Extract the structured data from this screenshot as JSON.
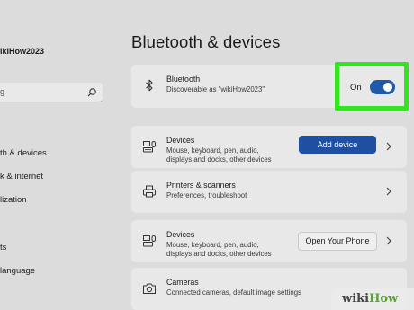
{
  "sidebar": {
    "account_name": "ikiHow2023",
    "search_value": "g",
    "items": [
      {
        "label": "th & devices"
      },
      {
        "label": "k & internet"
      },
      {
        "label": "lization"
      },
      {
        "label": "ts"
      },
      {
        "label": "language"
      }
    ]
  },
  "main": {
    "title": "Bluetooth & devices",
    "bluetooth": {
      "title": "Bluetooth",
      "subtitle": "Discoverable as \"wikiHow2023\"",
      "toggle_label": "On",
      "toggle_state": "on"
    },
    "cards": [
      {
        "icon": "devices-icon",
        "title": "Devices",
        "subtitle_lines": [
          "Mouse, keyboard, pen, audio,",
          "displays and docks, other devices"
        ],
        "button": "Add device"
      },
      {
        "icon": "printer-icon",
        "title": "Printers & scanners",
        "subtitle_lines": [
          "Preferences, troubleshoot"
        ]
      },
      {
        "icon": "devices-icon",
        "title": "Devices",
        "subtitle_lines": [
          "Mouse, keyboard, pen, audio,",
          "displays and docks, other devices"
        ],
        "button": "Open Your Phone"
      },
      {
        "icon": "camera-icon",
        "title": "Cameras",
        "subtitle_lines": [
          "Connected cameras, default image settings"
        ]
      }
    ]
  },
  "watermark": {
    "part1": "wiki",
    "part2": "How"
  },
  "colors": {
    "accent": "#1e4fa1",
    "highlight": "#33e51f",
    "background": "#dcdcdc",
    "card": "#e8e8e8"
  }
}
